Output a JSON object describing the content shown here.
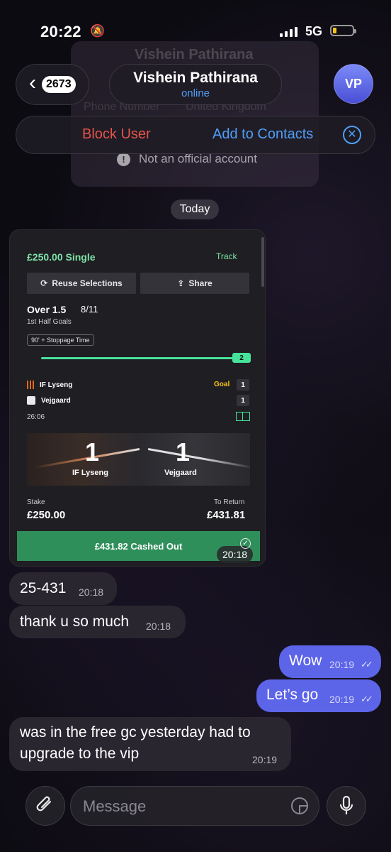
{
  "status_bar": {
    "time": "20:22",
    "network": "5G"
  },
  "ghost": {
    "name": "Vishein Pathirana",
    "row_left": "Phone Number",
    "row_right": "United Kingdom"
  },
  "header": {
    "back_count": "2673",
    "contact_name": "Vishein Pathirana",
    "contact_status": "online",
    "avatar_initials": "VP"
  },
  "action_bar": {
    "block_label": "Block User",
    "add_label": "Add to Contacts"
  },
  "notice": {
    "text": "Not an official account"
  },
  "date_chip": "Today",
  "bet": {
    "header": "£250.00  Single",
    "track": "Track",
    "reuse": "Reuse Selections",
    "share": "Share",
    "market": "Over 1.5",
    "odds": "8/11",
    "market_sub": "1st Half Goals",
    "time_chip": "90' + Stoppage Time",
    "progress_value": "2",
    "team1": "IF Lyseng",
    "team2": "Vejgaard",
    "goal_tag": "Goal",
    "score1": "1",
    "score2": "1",
    "clock": "26:06",
    "big_score1": "1",
    "big_score2": "1",
    "stake_label": "Stake",
    "stake_value": "£250.00",
    "return_label": "To Return",
    "return_value": "£431.81",
    "cashed_out": "£431.82  Cashed Out",
    "image_time": "20:18"
  },
  "messages": [
    {
      "dir": "in",
      "text": "25-431",
      "time": "20:18"
    },
    {
      "dir": "in",
      "text": "thank u so much",
      "time": "20:18"
    },
    {
      "dir": "out",
      "text": "Wow",
      "time": "20:19"
    },
    {
      "dir": "out",
      "text": "Let’s go",
      "time": "20:19"
    },
    {
      "dir": "in",
      "text_line1": "was in the free gc yesterday had to",
      "text_line2": "upgrade to the vip",
      "time": "20:19"
    }
  ],
  "composer": {
    "placeholder": "Message"
  }
}
